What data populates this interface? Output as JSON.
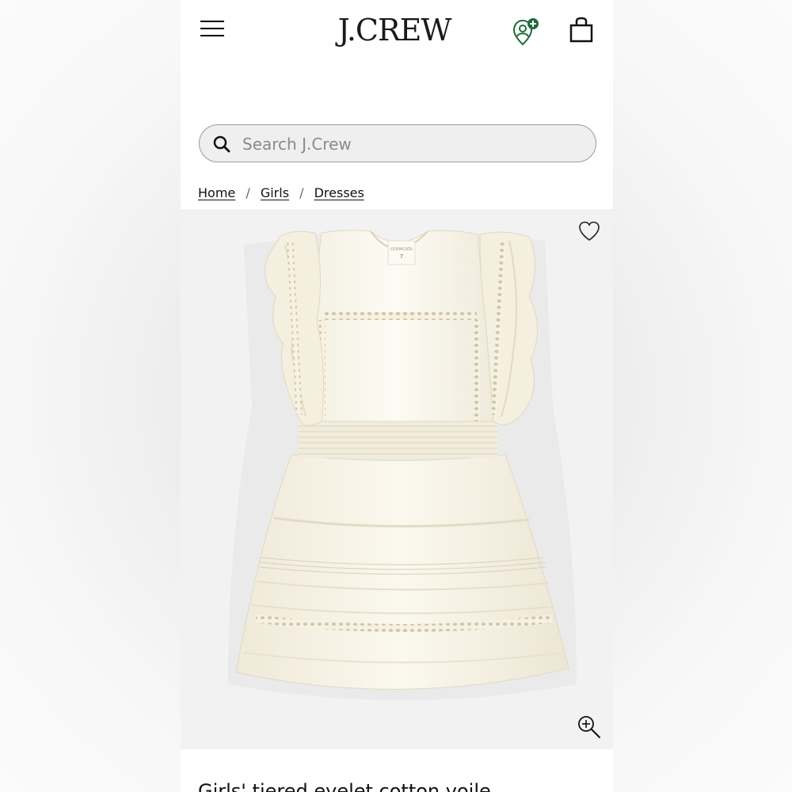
{
  "header": {
    "logo_text": "J.CREW",
    "menu_icon": "hamburger-menu-icon",
    "account_icon": "account-add-icon",
    "cart_icon": "shopping-bag-icon",
    "account_badge_color": "#1f6b3a"
  },
  "search": {
    "placeholder": "Search J.Crew",
    "value": "",
    "icon": "search-icon"
  },
  "breadcrumb": {
    "items": [
      "Home",
      "Girls",
      "Dresses"
    ],
    "separator": "/"
  },
  "product": {
    "image_alt": "Cream tiered eyelet ruffle dress",
    "label_brand": "crewcuts",
    "label_size": "7",
    "wishlist_icon": "heart-outline-icon",
    "zoom_icon": "zoom-in-icon",
    "title_partial": "Girls' tiered eyelet cotton voile..."
  }
}
